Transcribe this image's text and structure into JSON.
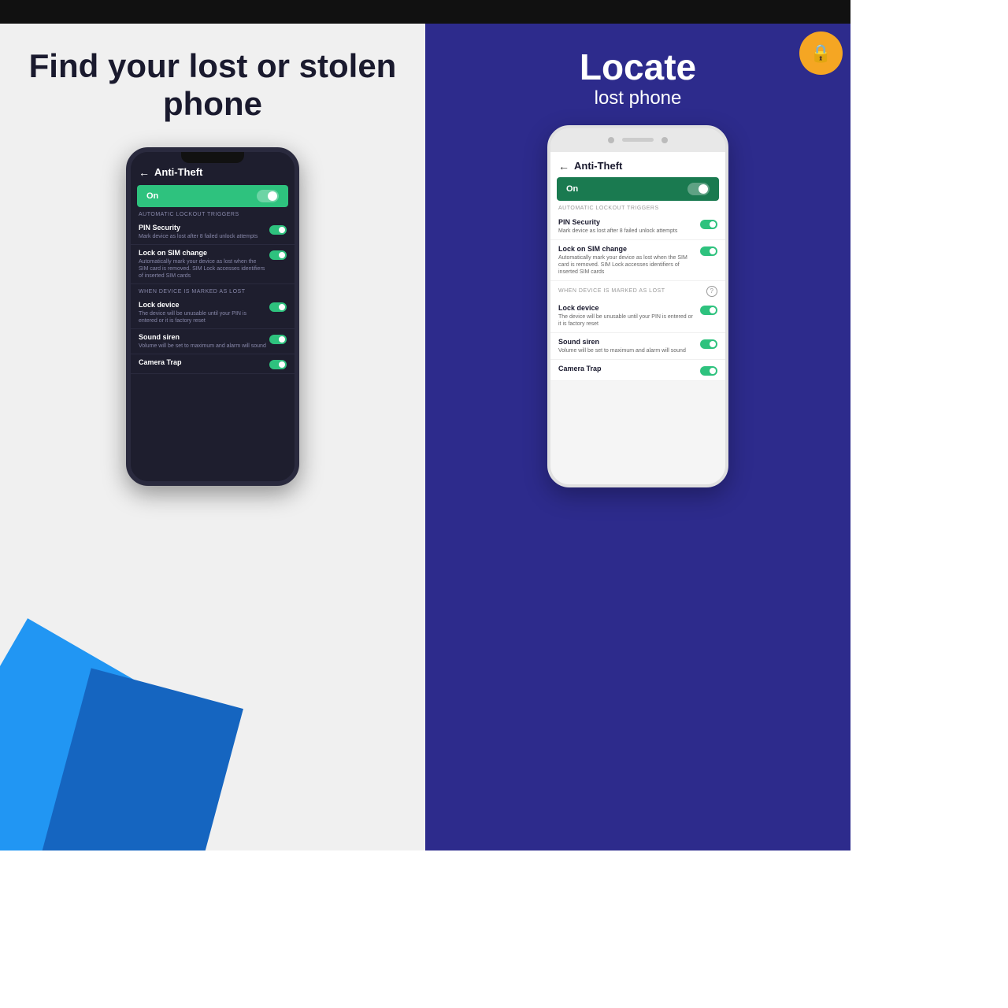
{
  "topBar": {
    "label": ""
  },
  "leftPanel": {
    "headline": "Find your lost or stolen phone",
    "phone": {
      "header": {
        "backArrow": "←",
        "title": "Anti-Theft"
      },
      "toggleBar": {
        "label": "On"
      },
      "sectionLabel": "AUTOMATIC LOCKOUT TRIGGERS",
      "settings": [
        {
          "title": "PIN Security",
          "desc": "Mark device as lost after 8 failed unlock attempts"
        },
        {
          "title": "Lock on SIM change",
          "desc": "Automatically mark your device as lost when the SIM card is removed. SIM Lock accesses identifiers of inserted SIM cards"
        }
      ],
      "sectionLabel2": "WHEN DEVICE IS MARKED AS LOST",
      "settings2": [
        {
          "title": "Lock device",
          "desc": "The device will be unusable until your PIN is entered or it is factory reset"
        },
        {
          "title": "Sound siren",
          "desc": "Volume will be set to maximum and alarm will sound"
        },
        {
          "title": "Camera Trap",
          "desc": ""
        }
      ]
    }
  },
  "rightPanel": {
    "headline": {
      "bigText": "Locate",
      "smallText": "lost phone"
    },
    "orangeBadge": {
      "icon": "🔒"
    },
    "phone": {
      "header": {
        "backArrow": "←",
        "title": "Anti-Theft"
      },
      "toggleBar": {
        "label": "On"
      },
      "sectionLabel": "AUTOMATIC LOCKOUT TRIGGERS",
      "settings": [
        {
          "title": "PIN Security",
          "desc": "Mark device as lost after 8 failed unlock attempts"
        },
        {
          "title": "Lock on SIM change",
          "desc": "Automatically mark your device as lost when the SIM card is removed. SIM Lock accesses identifiers of inserted SIM cards"
        }
      ],
      "sectionLabel2": "WHEN DEVICE IS MARKED AS LOST",
      "settings2": [
        {
          "title": "Lock device",
          "desc": "The device will be unusable until your PIN is entered or it is factory reset"
        },
        {
          "title": "Sound siren",
          "desc": "Volume will be set to maximum and alarm will sound"
        },
        {
          "title": "Camera Trap",
          "desc": ""
        }
      ]
    }
  }
}
